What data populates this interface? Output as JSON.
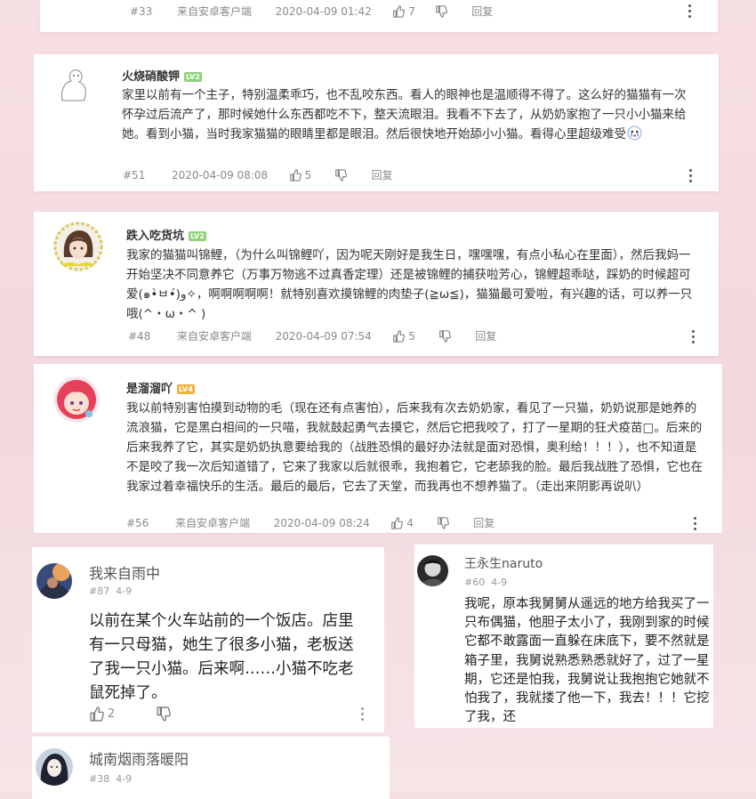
{
  "posts": [
    {
      "floor": "#33",
      "source": "来自安卓客户端",
      "time": "2020-04-09 01:42",
      "likes": "7",
      "reply": "回复"
    },
    {
      "user": "火烧硝酸钾",
      "level": "LV2",
      "text": "家里以前有一个主子，特别温柔乖巧，也不乱咬东西。看人的眼神也是温顺得不得了。这么好的猫猫有一次怀孕过后流产了，那时候她什么东西都吃不下，整天流眼泪。我看不下去了，从奶奶家抱了一只小小猫来给她。看到小猫，当时我家猫猫的眼睛里都是眼泪。然后很快地开始舔小小猫。看得心里超级难受",
      "floor": "#51",
      "time": "2020-04-09 08:08",
      "likes": "5",
      "reply": "回复"
    },
    {
      "user": "跌入吃货坑",
      "level": "LV2",
      "text": "我家的猫猫叫锦鲤，（为什么叫锦鲤吖，因为呢天刚好是我生日，嘿嘿嘿，有点小私心在里面），然后我妈一开始坚决不同意养它（万事万物逃不过真香定理）还是被锦鲤的捕获啦芳心，锦鲤超乖哒，踩奶的时候超可爱(๑•̀ㅂ•́)و✧，啊啊啊啊啊！就特别喜欢摸锦鲤的肉垫子(≧ω≦)，猫猫最可爱啦，有兴趣的话，可以养一只哦(^・ω・^ )",
      "floor": "#48",
      "source": "来自安卓客户端",
      "time": "2020-04-09 07:54",
      "likes": "5",
      "reply": "回复"
    },
    {
      "user": "是溜溜吖",
      "level": "LV4",
      "text": "我以前特别害怕摸到动物的毛（现在还有点害怕），后来我有次去奶奶家，看见了一只猫，奶奶说那是她养的流浪猫，它是黑白相间的一只喵，我就鼓起勇气去摸它，然后它把我咬了，打了一星期的狂犬疫苗□。后来的后来我养了它，其实是奶奶执意要给我的（战胜恐惧的最好办法就是面对恐惧，奥利给！！！），也不知道是不是咬了我一次后知道错了，它来了我家以后就很乖，我抱着它，它老舔我的脸。最后我战胜了恐惧，它也在我家过着幸福快乐的生活。最后的最后，它去了天堂，而我再也不想养猫了。（走出来阴影再说叭）",
      "floor": "#56",
      "source": "来自安卓客户端",
      "time": "2020-04-09 08:24",
      "likes": "4",
      "reply": "回复"
    }
  ],
  "notes": [
    {
      "user": "我来自雨中",
      "floor": "#87",
      "date": "4-9",
      "text": "以前在某个火车站前的一个饭店。店里有一只母猫，她生了很多小猫，老板送了我一只小猫。后来啊……小猫不吃老鼠死掉了。",
      "likes": "2"
    },
    {
      "user": "王永生naruto",
      "floor": "#60",
      "date": "4-9",
      "text": "我呢，原本我舅舅从遥远的地方给我买了一只布偶猫，他胆子太小了，我刚到家的时候它都不敢露面一直躲在床底下，要不然就是箱子里，我舅说熟悉熟悉就好了，过了一星期，它还是怕我，我舅说让我抱抱它她就不怕我了，我就搂了他一下，我去！！！它挖了我，还"
    },
    {
      "user": "城南烟雨落暖阳",
      "floor": "#38",
      "date": "4-9"
    }
  ],
  "colors": {
    "lv2": "#8fd17a",
    "lv4": "#f2b23a",
    "meta": "#8a8a8a"
  },
  "icons": [
    "thumb-up-icon",
    "thumb-down-icon",
    "more-vertical-icon",
    "crying-emoji-icon"
  ]
}
